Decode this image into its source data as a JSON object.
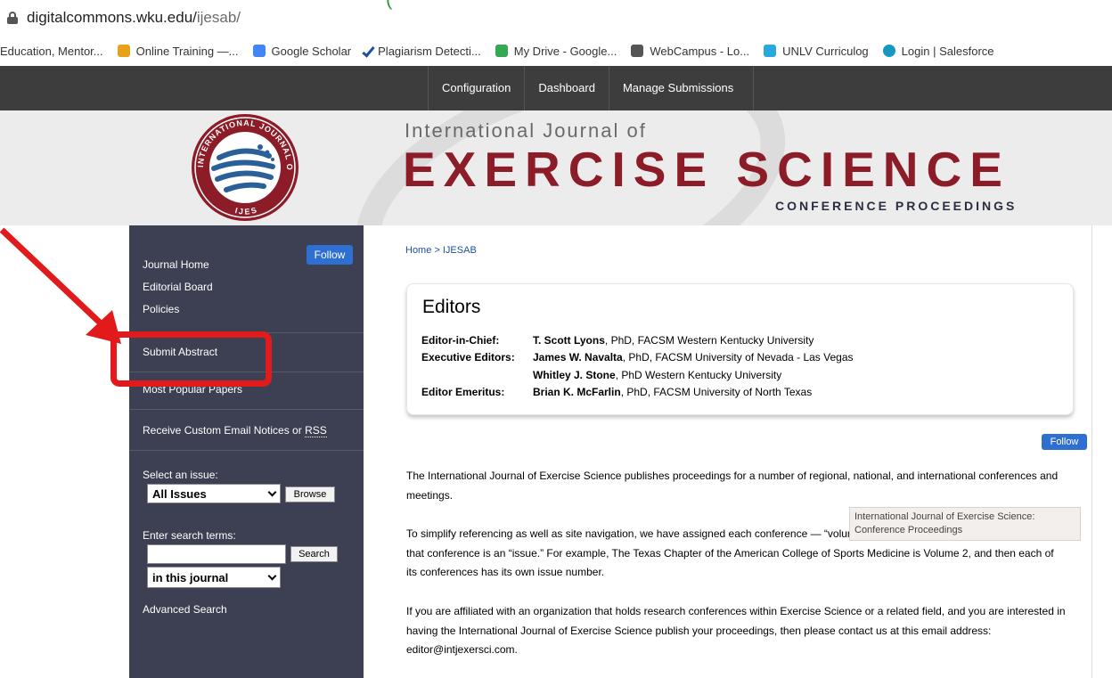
{
  "browser": {
    "url_host": "digitalcommons.wku.edu/",
    "url_path": "ijesab/",
    "top_fragment": "(",
    "bookmarks": [
      {
        "label": "Education, Mentor...",
        "icon": "none",
        "color": ""
      },
      {
        "label": "Online Training —...",
        "icon": "colorful-gem-icon",
        "color": "#e8a21a"
      },
      {
        "label": "Google Scholar",
        "icon": "scholar-cap-icon",
        "color": "#4285f4"
      },
      {
        "label": "Plagiarism Detecti...",
        "icon": "checkmark-icon",
        "color": "#1b4fa0"
      },
      {
        "label": "My Drive - Google...",
        "icon": "drive-icon",
        "color": "#34a853"
      },
      {
        "label": "WebCampus - Lo...",
        "icon": "key-icon",
        "color": "#555555"
      },
      {
        "label": "UNLV Curriculog",
        "icon": "curriculog-icon",
        "color": "#29a8e0"
      },
      {
        "label": "Login | Salesforce",
        "icon": "cloud-icon",
        "color": "#1798c1"
      }
    ]
  },
  "admin_nav": [
    "Configuration",
    "Dashboard",
    "Manage Submissions"
  ],
  "banner": {
    "small_title": "International Journal of",
    "big_title": "EXERCISE SCIENCE",
    "subtitle": "CONFERENCE PROCEEDINGS",
    "seal_top_text": "INTERNATIONAL JOURNAL OF EXERCISE SCIENCE",
    "seal_bottom_text": "IJES",
    "accent": "#8b1c28"
  },
  "sidebar": {
    "follow": "Follow",
    "links_top": [
      "Journal Home",
      "Editorial Board",
      "Policies"
    ],
    "submit_abstract": "Submit Abstract",
    "most_popular": "Most Popular Papers",
    "custom_notices_prefix": "Receive Custom Email Notices or ",
    "custom_notices_rss": "RSS",
    "select_issue_label": "Select an issue:",
    "issue_value": "All Issues",
    "browse": "Browse",
    "search_label": "Enter search terms:",
    "search_button": "Search",
    "scope_value": "in this journal",
    "advanced_search": "Advanced Search"
  },
  "main": {
    "breadcrumb": "Home > IJESAB",
    "editors_title": "Editors",
    "editors": [
      {
        "role": "Editor-in-Chief:",
        "name": "T. Scott Lyons",
        "rest": ", PhD, FACSM Western Kentucky University"
      },
      {
        "role": "Executive Editors:",
        "name": "James W. Navalta",
        "rest": ", PhD, FACSM University of Nevada - Las Vegas"
      },
      {
        "role": "",
        "name": "Whitley J. Stone",
        "rest": ", PhD Western Kentucky University"
      },
      {
        "role": "Editor Emeritus:",
        "name": "Brian K. McFarlin",
        "rest": ", PhD, FACSM University of North Texas"
      }
    ],
    "follow": "Follow",
    "paragraphs": [
      "The International Journal of Exercise Science publishes proceedings for a number of regional, national, and international conferences and meetings.",
      "To simplify referencing as well as site navigation, we have assigned each conference — “volume,” and thus each year’s proceedings for that conference is an “issue.” For example, The Texas Chapter of the American College of Sports Medicine is Volume 2, and then each of its conferences has its own issue number.",
      "If you are affiliated with an organization that holds research conferences within Exercise Science or a related field, and you are interested in having the International Journal of Exercise Science publish your proceedings, then please contact us at this email address: editor@intjexersci.com."
    ],
    "tooltip": "International Journal of Exercise Science: Conference Proceedings"
  },
  "annotation": {
    "color": "#e11b1b"
  }
}
